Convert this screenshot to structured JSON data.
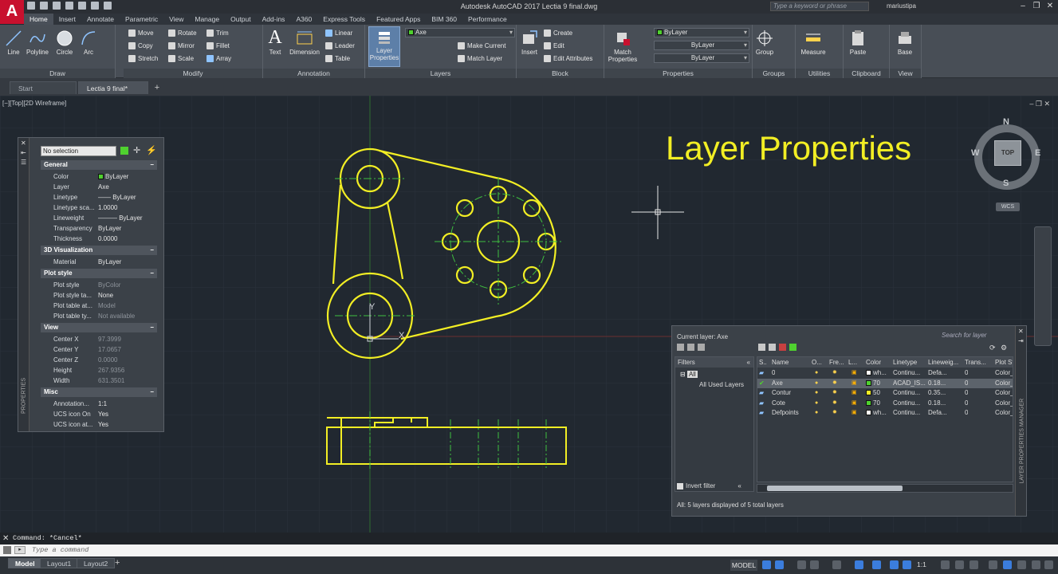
{
  "window": {
    "title": "Autodesk AutoCAD 2017    Lectia 9 final.dwg",
    "search_placeholder": "Type a keyword or phrase",
    "user": "mariustipa",
    "app_letter": "A"
  },
  "ribbon_tabs": [
    "Home",
    "Insert",
    "Annotate",
    "Parametric",
    "View",
    "Manage",
    "Output",
    "Add-ins",
    "A360",
    "Express Tools",
    "Featured Apps",
    "BIM 360",
    "Performance"
  ],
  "panels": {
    "draw": {
      "title": "Draw",
      "tools": [
        "Line",
        "Polyline",
        "Circle",
        "Arc"
      ]
    },
    "modify": {
      "title": "Modify",
      "tools": [
        "Move",
        "Rotate",
        "Trim",
        "Copy",
        "Mirror",
        "Fillet",
        "Stretch",
        "Scale",
        "Array"
      ]
    },
    "annotation": {
      "title": "Annotation",
      "tools": [
        "Text",
        "Dimension",
        "Linear",
        "Leader",
        "Table"
      ]
    },
    "layers": {
      "title": "Layers",
      "big_tool": "Layer Properties",
      "layer_combo": "Axe",
      "tools": [
        "Make Current",
        "Match Layer"
      ]
    },
    "block": {
      "title": "Block",
      "big_tool": "Insert",
      "tools": [
        "Create",
        "Edit",
        "Edit Attributes"
      ]
    },
    "properties": {
      "title": "Properties",
      "big_tool": "Match Properties",
      "color_combo": "ByLayer",
      "linetype_combo": "ByLayer",
      "lineweight_combo": "ByLayer"
    },
    "groups": {
      "title": "Groups",
      "big_tool": "Group"
    },
    "utilities": {
      "title": "Utilities",
      "big_tool": "Measure"
    },
    "clipboard": {
      "title": "Clipboard",
      "big_tool": "Paste"
    },
    "view": {
      "title": "View",
      "big_tool": "Base"
    }
  },
  "doc_tabs": [
    "Start",
    "Lectia 9 final*"
  ],
  "viewport_label": "[−][Top][2D Wireframe]",
  "overlay_title": "Layer Properties",
  "properties_palette": {
    "selection": "No selection",
    "vertical_label": "PROPERTIES",
    "sections": [
      {
        "title": "General",
        "rows": [
          {
            "name": "Color",
            "value": "ByLayer"
          },
          {
            "name": "Layer",
            "value": "Axe"
          },
          {
            "name": "Linetype",
            "value": "—— ByLayer"
          },
          {
            "name": "Linetype sca...",
            "value": "1.0000"
          },
          {
            "name": "Lineweight",
            "value": "——— ByLayer"
          },
          {
            "name": "Transparency",
            "value": "ByLayer"
          },
          {
            "name": "Thickness",
            "value": "0.0000"
          }
        ]
      },
      {
        "title": "3D Visualization",
        "rows": [
          {
            "name": "Material",
            "value": "ByLayer"
          }
        ]
      },
      {
        "title": "Plot style",
        "rows": [
          {
            "name": "Plot style",
            "value": "ByColor"
          },
          {
            "name": "Plot style ta...",
            "value": "None"
          },
          {
            "name": "Plot table at...",
            "value": "Model"
          },
          {
            "name": "Plot table ty...",
            "value": "Not available"
          }
        ]
      },
      {
        "title": "View",
        "rows": [
          {
            "name": "Center X",
            "value": "97.3999"
          },
          {
            "name": "Center Y",
            "value": "17.0657"
          },
          {
            "name": "Center Z",
            "value": "0.0000"
          },
          {
            "name": "Height",
            "value": "267.9356"
          },
          {
            "name": "Width",
            "value": "631.3501"
          }
        ]
      },
      {
        "title": "Misc",
        "rows": [
          {
            "name": "Annotation...",
            "value": "1:1"
          },
          {
            "name": "UCS icon On",
            "value": "Yes"
          },
          {
            "name": "UCS icon at...",
            "value": "Yes"
          }
        ]
      }
    ]
  },
  "layer_manager": {
    "current_layer": "Current layer: Axe",
    "search_placeholder": "Search for layer",
    "vertical_label": "LAYER PROPERTIES MANAGER",
    "filters_header": "Filters",
    "filter_all": "All",
    "filter_used": "All Used Layers",
    "invert_filter": "Invert filter",
    "status": "All: 5 layers displayed of 5 total layers",
    "columns": [
      "S..",
      "Name",
      "O...",
      "Fre...",
      "L...",
      "Color",
      "Linetype",
      "Lineweig...",
      "Trans...",
      "Plot St"
    ],
    "rows": [
      {
        "name": "0",
        "color_label": "wh...",
        "color_hex": "#ffffff",
        "linetype": "Continu...",
        "lineweight": "Defa...",
        "trans": "0",
        "plot": "Color_",
        "current": false
      },
      {
        "name": "Axe",
        "color_label": "70",
        "color_hex": "#4fd12f",
        "linetype": "ACAD_IS...",
        "lineweight": "0.18...",
        "trans": "0",
        "plot": "Color_",
        "current": true
      },
      {
        "name": "Contur",
        "color_label": "50",
        "color_hex": "#f2ee24",
        "linetype": "Continu...",
        "lineweight": "0.35...",
        "trans": "0",
        "plot": "Color_",
        "current": false
      },
      {
        "name": "Cote",
        "color_label": "70",
        "color_hex": "#4fd12f",
        "linetype": "Continu...",
        "lineweight": "0.18...",
        "trans": "0",
        "plot": "Color_",
        "current": false
      },
      {
        "name": "Defpoints",
        "color_label": "wh...",
        "color_hex": "#ffffff",
        "linetype": "Continu...",
        "lineweight": "Defa...",
        "trans": "0",
        "plot": "Color_",
        "current": false
      }
    ]
  },
  "viewcube": {
    "face": "TOP",
    "n": "N",
    "s": "S",
    "e": "E",
    "w": "W",
    "wcs": "WCS"
  },
  "command": {
    "history": "Command: *Cancel*",
    "placeholder": "Type a command"
  },
  "status": {
    "layout_tabs": [
      "Model",
      "Layout1",
      "Layout2"
    ],
    "model_button": "MODEL",
    "scale": "1:1"
  },
  "colors": {
    "contour": "#f2ee24",
    "axis": "#3fbf3f",
    "background": "#212830"
  }
}
